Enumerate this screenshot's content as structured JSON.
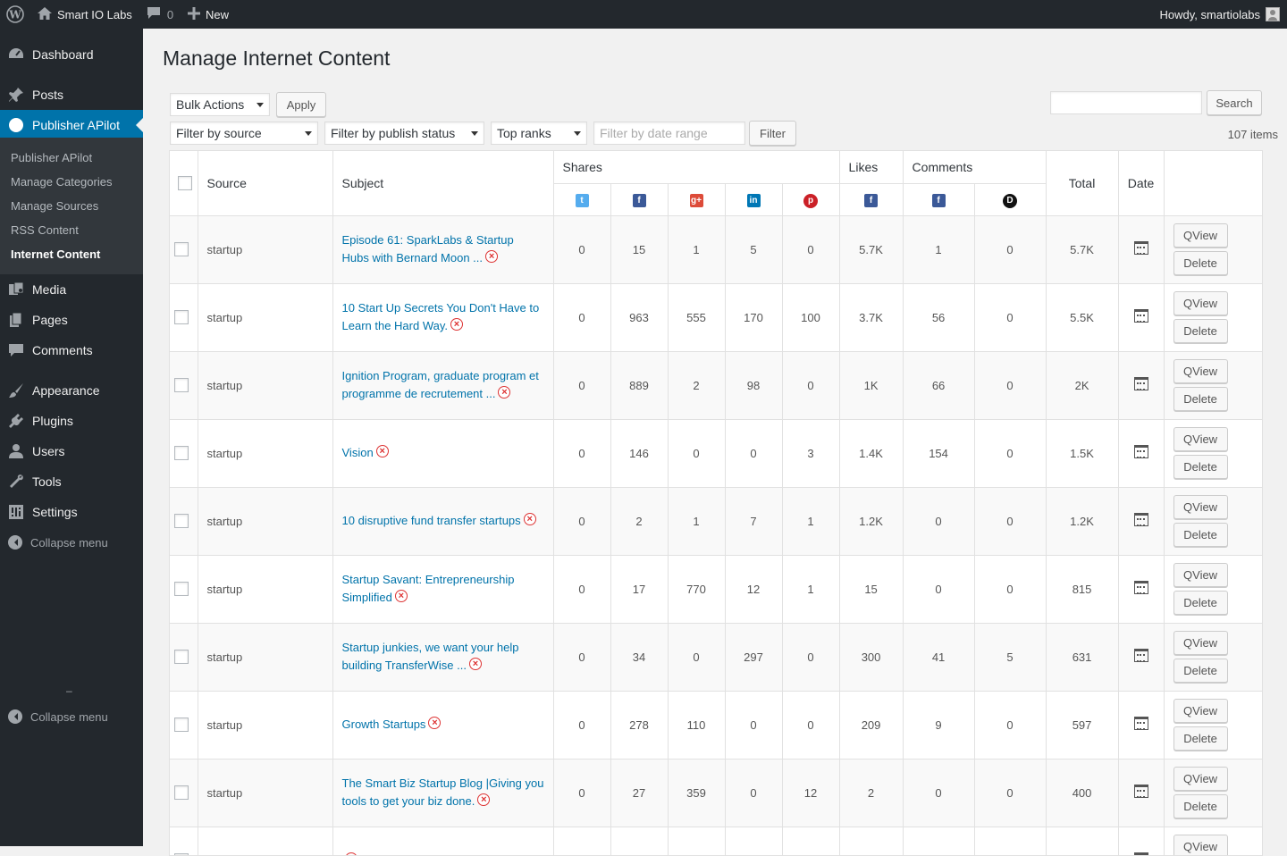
{
  "adminbar": {
    "site_name": "Smart IO Labs",
    "comments_count": "0",
    "new_label": "New",
    "howdy": "Howdy, smartiolabs"
  },
  "sidebar": {
    "items": [
      {
        "label": "Dashboard",
        "icon": "dashboard-icon"
      },
      {
        "label": "Posts",
        "icon": "pin-icon"
      },
      {
        "label": "Publisher APilot",
        "icon": "circle-icon"
      },
      {
        "label": "Media",
        "icon": "media-icon"
      },
      {
        "label": "Pages",
        "icon": "pages-icon"
      },
      {
        "label": "Comments",
        "icon": "comments-icon"
      },
      {
        "label": "Appearance",
        "icon": "brush-icon"
      },
      {
        "label": "Plugins",
        "icon": "plugin-icon"
      },
      {
        "label": "Users",
        "icon": "users-icon"
      },
      {
        "label": "Tools",
        "icon": "wrench-icon"
      },
      {
        "label": "Settings",
        "icon": "settings-icon"
      }
    ],
    "submenu": [
      "Publisher APilot",
      "Manage Categories",
      "Manage Sources",
      "RSS Content",
      "Internet Content"
    ],
    "collapse_label": "Collapse menu",
    "dash_mark": "–"
  },
  "page": {
    "title": "Manage Internet Content",
    "bulk_actions": "Bulk Actions",
    "apply": "Apply",
    "filter_source": "Filter by source",
    "filter_status": "Filter by publish status",
    "top_ranks": "Top ranks",
    "date_placeholder": "Filter by date range",
    "filter_btn": "Filter",
    "search_btn": "Search",
    "items_count": "107 items"
  },
  "table": {
    "headers": {
      "source": "Source",
      "subject": "Subject",
      "shares": "Shares",
      "likes": "Likes",
      "comments": "Comments",
      "total": "Total",
      "date": "Date"
    },
    "qview": "QView",
    "delete": "Delete",
    "rows": [
      {
        "source": "startup",
        "subject": "Episode 61: SparkLabs & Startup Hubs with Bernard Moon ...",
        "tw": "0",
        "fb": "15",
        "gp": "1",
        "li": "5",
        "pi": "0",
        "likes_fb": "5.7K",
        "com_fb": "1",
        "com_dq": "0",
        "total": "5.7K"
      },
      {
        "source": "startup",
        "subject": "10 Start Up Secrets You Don't Have to Learn the Hard Way.",
        "tw": "0",
        "fb": "963",
        "gp": "555",
        "li": "170",
        "pi": "100",
        "likes_fb": "3.7K",
        "com_fb": "56",
        "com_dq": "0",
        "total": "5.5K"
      },
      {
        "source": "startup",
        "subject": "Ignition Program, graduate program et programme de recrutement ...",
        "tw": "0",
        "fb": "889",
        "gp": "2",
        "li": "98",
        "pi": "0",
        "likes_fb": "1K",
        "com_fb": "66",
        "com_dq": "0",
        "total": "2K"
      },
      {
        "source": "startup",
        "subject": "Vision",
        "tw": "0",
        "fb": "146",
        "gp": "0",
        "li": "0",
        "pi": "3",
        "likes_fb": "1.4K",
        "com_fb": "154",
        "com_dq": "0",
        "total": "1.5K"
      },
      {
        "source": "startup",
        "subject": "10 disruptive fund transfer startups",
        "tw": "0",
        "fb": "2",
        "gp": "1",
        "li": "7",
        "pi": "1",
        "likes_fb": "1.2K",
        "com_fb": "0",
        "com_dq": "0",
        "total": "1.2K"
      },
      {
        "source": "startup",
        "subject": "Startup Savant: Entrepreneurship Simplified",
        "tw": "0",
        "fb": "17",
        "gp": "770",
        "li": "12",
        "pi": "1",
        "likes_fb": "15",
        "com_fb": "0",
        "com_dq": "0",
        "total": "815"
      },
      {
        "source": "startup",
        "subject": "Startup junkies, we want your help building TransferWise ...",
        "tw": "0",
        "fb": "34",
        "gp": "0",
        "li": "297",
        "pi": "0",
        "likes_fb": "300",
        "com_fb": "41",
        "com_dq": "5",
        "total": "631"
      },
      {
        "source": "startup",
        "subject": "Growth Startups",
        "tw": "0",
        "fb": "278",
        "gp": "110",
        "li": "0",
        "pi": "0",
        "likes_fb": "209",
        "com_fb": "9",
        "com_dq": "0",
        "total": "597"
      },
      {
        "source": "startup",
        "subject": "The Smart Biz Startup Blog |Giving you tools to get your biz done.",
        "tw": "0",
        "fb": "27",
        "gp": "359",
        "li": "0",
        "pi": "12",
        "likes_fb": "2",
        "com_fb": "0",
        "com_dq": "0",
        "total": "400"
      },
      {
        "source": "",
        "subject": "",
        "tw": "",
        "fb": "",
        "gp": "",
        "li": "",
        "pi": "",
        "likes_fb": "",
        "com_fb": "",
        "com_dq": "",
        "total": ""
      }
    ]
  },
  "colors": {
    "admin_bg": "#23282d",
    "accent": "#0073aa",
    "link": "#0073aa",
    "remove": "#dd3333"
  }
}
